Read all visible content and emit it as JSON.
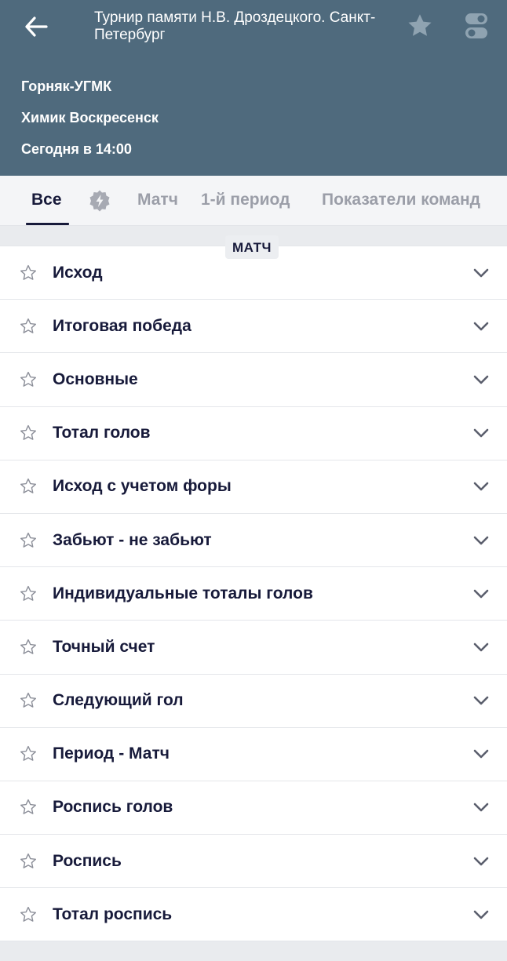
{
  "header": {
    "title": "Турнир памяти Н.В. Дроздецкого. Санкт-Петербург",
    "team1": "Горняк-УГМК",
    "team2": "Химик Воскресенск",
    "start_time": "Сегодня в 14:00"
  },
  "tabs": [
    {
      "label": "Все",
      "active": true
    },
    {
      "label": "Матч",
      "active": false
    },
    {
      "label": "1-й период",
      "active": false
    },
    {
      "label": "Показатели команд",
      "active": false
    }
  ],
  "section_label": "МАТЧ",
  "markets": [
    {
      "label": "Исход"
    },
    {
      "label": "Итоговая победа"
    },
    {
      "label": "Основные"
    },
    {
      "label": "Тотал голов"
    },
    {
      "label": "Исход с учетом форы"
    },
    {
      "label": "Забьют - не забьют"
    },
    {
      "label": "Индивидуальные тоталы голов"
    },
    {
      "label": "Точный счет"
    },
    {
      "label": "Следующий гол"
    },
    {
      "label": "Период - Матч"
    },
    {
      "label": "Роспись голов"
    },
    {
      "label": "Роспись"
    },
    {
      "label": "Тотал роспись"
    }
  ],
  "colors": {
    "header_bg": "#4f6a7d",
    "text_dark": "#171a3a",
    "tab_inactive": "#9b9ea8"
  }
}
